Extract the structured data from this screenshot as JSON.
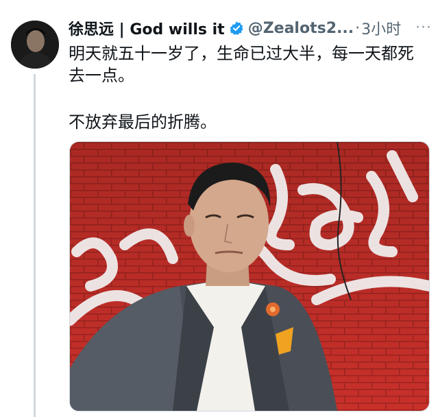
{
  "tweet": {
    "author_name": "徐思远 | God wills it",
    "verified_icon": "verified-badge-icon",
    "handle": "@Zealots2...",
    "separator": "·",
    "time": "3小时",
    "more_icon": "more-dots-icon",
    "more_label": "···",
    "text_para1": "明天就五十一岁了，生命已过大半，每一天都死去一点。",
    "text_para2": "不放弃最后的折腾。"
  },
  "colors": {
    "verified_blue": "#1d9bf0",
    "text_primary": "#0f1419",
    "text_secondary": "#536471",
    "brick_red": "#c8302a"
  }
}
